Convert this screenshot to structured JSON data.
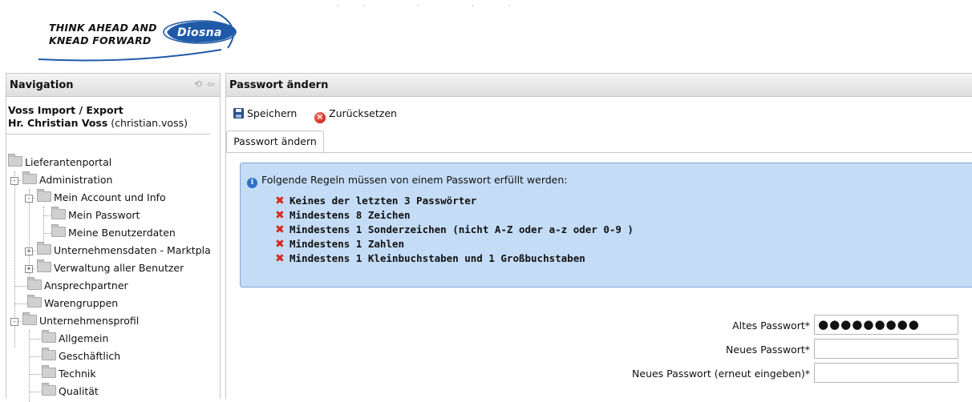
{
  "header": {
    "tagline_line1": "THINK AHEAD AND",
    "tagline_line2": "KNEAD FORWARD",
    "brand": "Diosna",
    "top_dots": [
      "·",
      "·",
      "·",
      "·",
      "·"
    ]
  },
  "navigation": {
    "title": "Navigation",
    "company": "Voss Import / Export",
    "user_name": "Hr. Christian Voss",
    "user_login": "(christian.voss)",
    "tree": [
      {
        "label": "Lieferantenportal",
        "level": 0,
        "toggle": ""
      },
      {
        "label": "Administration",
        "level": 1,
        "toggle": "-"
      },
      {
        "label": "Mein Account und Info",
        "level": 2,
        "toggle": "-"
      },
      {
        "label": "Mein Passwort",
        "level": 3,
        "toggle": ""
      },
      {
        "label": "Meine Benutzerdaten",
        "level": 3,
        "toggle": ""
      },
      {
        "label": "Unternehmensdaten - Marktpla",
        "level": 2,
        "toggle": "+"
      },
      {
        "label": "Verwaltung aller Benutzer",
        "level": 2,
        "toggle": "+"
      },
      {
        "label": "Ansprechpartner",
        "level": 1,
        "toggle": ""
      },
      {
        "label": "Warengruppen",
        "level": 1,
        "toggle": ""
      },
      {
        "label": "Unternehmensprofil",
        "level": 1,
        "toggle": "-"
      },
      {
        "label": "Allgemein",
        "level": 2,
        "toggle": ""
      },
      {
        "label": "Geschäftlich",
        "level": 2,
        "toggle": ""
      },
      {
        "label": "Technik",
        "level": 2,
        "toggle": ""
      },
      {
        "label": "Qualität",
        "level": 2,
        "toggle": ""
      }
    ]
  },
  "main": {
    "title": "Passwort ändern",
    "toolbar": {
      "save_label": "Speichern",
      "reset_label": "Zurücksetzen"
    },
    "tab_label": "Passwort ändern",
    "info": {
      "heading": "Folgende Regeln müssen von einem Passwort erfüllt werden:",
      "rules": [
        "Keines der letzten 3 Passwörter",
        "Mindestens 8 Zeichen",
        "Mindestens 1 Sonderzeichen (nicht A-Z oder a-z oder 0-9 )",
        "Mindestens 1 Zahlen",
        "Mindestens 1 Kleinbuchstaben und 1 Großbuchstaben"
      ]
    },
    "form": {
      "old_label": "Altes Passwort*",
      "old_value": "●●●●●●●●●",
      "new_label": "Neues Passwort*",
      "new_value": "",
      "repeat_label": "Neues Passwort (erneut eingeben)*",
      "repeat_value": ""
    }
  },
  "colors": {
    "info_bg": "#c4dcf6",
    "info_border": "#7fa7d6",
    "error_x": "#d42a1f",
    "brand_blue": "#1f5aa8"
  }
}
